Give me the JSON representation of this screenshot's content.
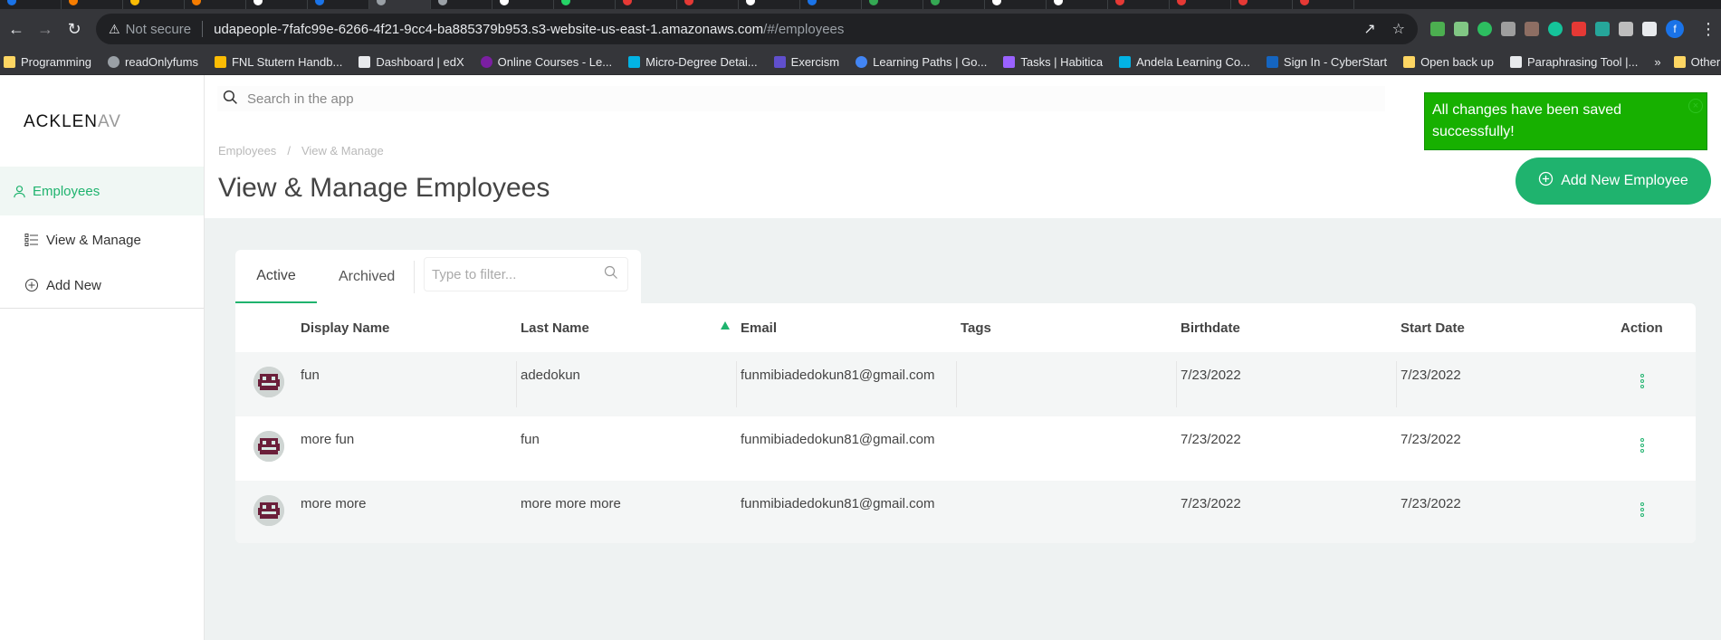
{
  "browser": {
    "not_secure_label": "Not secure",
    "url_host": "udapeople-7fafc99e-6266-4f21-9cc4-ba885379b953.s3-website-us-east-1.amazonaws.com",
    "url_path": "/#/employees",
    "profile_letter": "f",
    "bookmarks": [
      "Programming",
      "readOnlyfums",
      "FNL Stutern Handb...",
      "Dashboard | edX",
      "Online Courses - Le...",
      "Micro-Degree Detai...",
      "Exercism",
      "Learning Paths | Go...",
      "Tasks | Habitica",
      "Andela Learning Co...",
      "Sign In - CyberStart",
      "Open back up",
      "Paraphrasing Tool |..."
    ],
    "other_bookmarks": "Other bookmarks"
  },
  "app": {
    "logo_main": "ACKLEN",
    "logo_faded": "AV",
    "search_placeholder": "Search in the app",
    "sidebar": {
      "employees": "Employees",
      "view_manage": "View & Manage",
      "add_new": "Add New"
    },
    "breadcrumb": [
      "Employees",
      "View & Manage"
    ],
    "page_title": "View & Manage Employees",
    "add_button": "Add New Employee",
    "toast": "All changes have been saved successfully!",
    "tabs": [
      "Active",
      "Archived"
    ],
    "filter_placeholder": "Type to filter...",
    "columns": [
      "Display Name",
      "Last Name",
      "Email",
      "Tags",
      "Birthdate",
      "Start Date",
      "Action"
    ],
    "rows": [
      {
        "display_name": "fun",
        "last_name": "adedokun",
        "email": "funmibiadedokun81@gmail.com",
        "tags": "",
        "birthdate": "7/23/2022",
        "start_date": "7/23/2022"
      },
      {
        "display_name": "more fun",
        "last_name": "fun",
        "email": "funmibiadedokun81@gmail.com",
        "tags": "",
        "birthdate": "7/23/2022",
        "start_date": "7/23/2022"
      },
      {
        "display_name": "more more",
        "last_name": "more more more",
        "email": "funmibiadedokun81@gmail.com",
        "tags": "",
        "birthdate": "7/23/2022",
        "start_date": "7/23/2022"
      }
    ]
  },
  "colors": {
    "accent": "#1fb36e",
    "toast": "#17b000",
    "content_bg": "#eef2f2"
  }
}
